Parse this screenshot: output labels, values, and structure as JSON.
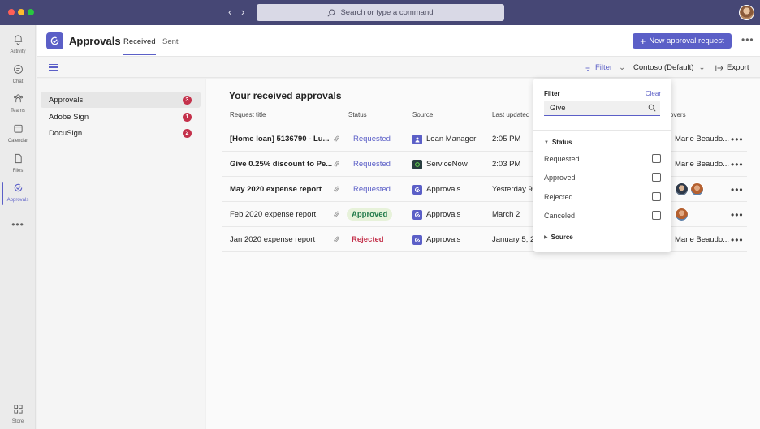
{
  "search": {
    "placeholder": "Search or type a command"
  },
  "rail": {
    "items": [
      {
        "label": "Activity"
      },
      {
        "label": "Chat"
      },
      {
        "label": "Teams"
      },
      {
        "label": "Calendar"
      },
      {
        "label": "Files"
      },
      {
        "label": "Approvals",
        "active": true
      }
    ],
    "more": "•••",
    "store": "Store"
  },
  "header": {
    "title": "Approvals",
    "tabs": [
      {
        "label": "Received",
        "active": true
      },
      {
        "label": "Sent"
      }
    ],
    "new_button": "New approval request",
    "more": "•••"
  },
  "toolbar": {
    "filter": "Filter",
    "org": "Contoso (Default)",
    "export": "Export"
  },
  "sidenav": {
    "items": [
      {
        "label": "Approvals",
        "count": "3",
        "selected": true
      },
      {
        "label": "Adobe Sign",
        "count": "1"
      },
      {
        "label": "DocuSign",
        "count": "2"
      }
    ]
  },
  "main": {
    "title": "Your received approvals",
    "columns": {
      "title": "Request title",
      "status": "Status",
      "source": "Source",
      "updated": "Last updated",
      "approvers": "overs"
    },
    "rows": [
      {
        "title": "[Home loan] 5136790 - Lu...",
        "bold": true,
        "status": "Requested",
        "source": "Loan Manager",
        "updated": "2:05 PM",
        "approvers": "Marie Beaudo..."
      },
      {
        "title": "Give 0.25% discount to Pe...",
        "bold": true,
        "status": "Requested",
        "source": "ServiceNow",
        "updated": "2:03 PM",
        "approvers": "Marie Beaudo..."
      },
      {
        "title": "May 2020 expense report",
        "bold": true,
        "status": "Requested",
        "source": "Approvals",
        "updated": "Yesterday 9:1",
        "approvers": ""
      },
      {
        "title": "Feb 2020 expense report",
        "bold": false,
        "status": "Approved",
        "source": "Approvals",
        "updated": "March 2",
        "approvers": ""
      },
      {
        "title": "Jan 2020 expense report",
        "bold": false,
        "status": "Rejected",
        "source": "Approvals",
        "updated": "January 5, 20",
        "approvers": "Marie Beaudo..."
      }
    ],
    "row_more": "•••"
  },
  "filter_panel": {
    "title": "Filter",
    "clear": "Clear",
    "input_value": "Give",
    "status_section": "Status",
    "options": [
      "Requested",
      "Approved",
      "Rejected",
      "Canceled"
    ],
    "source_section": "Source"
  },
  "colors": {
    "brand": "#5b5fc7",
    "titlebar": "#464775",
    "badge": "#c4314b",
    "approved": "#237b4b",
    "rejected": "#c4314b"
  }
}
